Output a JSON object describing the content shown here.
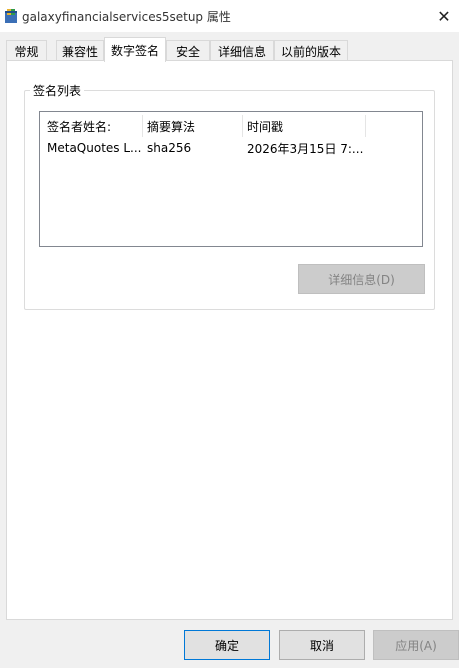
{
  "window": {
    "title": "galaxyfinancialservices5setup 属性",
    "close_glyph": "✕"
  },
  "tabs": [
    {
      "label": "常规"
    },
    {
      "label": "兼容性"
    },
    {
      "label": "数字签名",
      "active": true
    },
    {
      "label": "安全"
    },
    {
      "label": "详细信息"
    },
    {
      "label": "以前的版本"
    }
  ],
  "signature_list": {
    "group_label": "签名列表",
    "columns": [
      "签名者姓名:",
      "摘要算法",
      "时间戳"
    ],
    "rows": [
      [
        "MetaQuotes L...",
        "sha256",
        "2026年3月15日 7:..."
      ]
    ],
    "details_button": "详细信息(D)"
  },
  "footer": {
    "ok": "确定",
    "cancel": "取消",
    "apply": "应用(A)"
  },
  "colors": {
    "accent": "#0078d7",
    "disabled_text": "#838383"
  },
  "icons": {
    "app": "setup-package-icon",
    "close": "close-icon"
  }
}
